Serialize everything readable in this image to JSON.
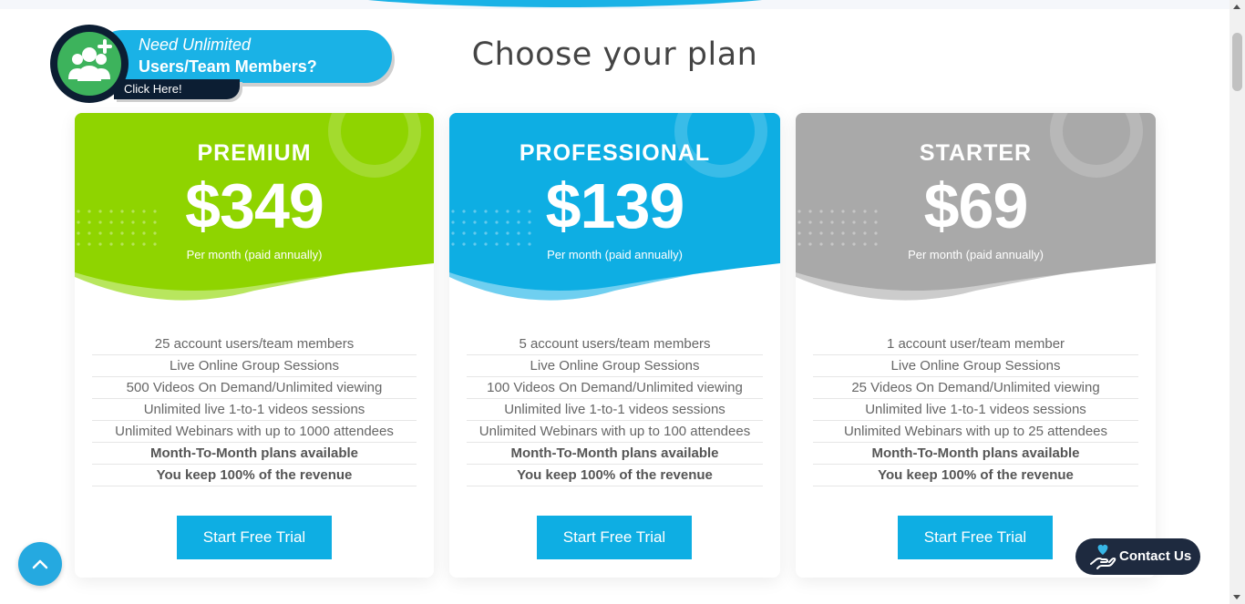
{
  "page": {
    "title": "Choose your plan"
  },
  "promo": {
    "line1": "Need Unlimited",
    "line2": "Users/Team Members?",
    "click": "Click Here!"
  },
  "plans": [
    {
      "tier": "PREMIUM",
      "price": "$349",
      "period": "Per month (paid annually)",
      "color": "#8fd400",
      "features": [
        "25 account users/team members",
        "Live Online Group Sessions",
        "500 Videos On Demand/Unlimited viewing",
        "Unlimited live 1-to-1 videos sessions",
        "Unlimited Webinars with up to 1000 attendees",
        "Month-To-Month plans available",
        "You keep 100% of the revenue"
      ],
      "cta": "Start Free Trial"
    },
    {
      "tier": "PROFESSIONAL",
      "price": "$139",
      "period": "Per month (paid annually)",
      "color": "#0eaee3",
      "features": [
        "5 account users/team members",
        "Live Online Group Sessions",
        "100 Videos On Demand/Unlimited viewing",
        "Unlimited live 1-to-1 videos sessions",
        "Unlimited Webinars with up to 100 attendees",
        "Month-To-Month plans available",
        "You keep 100% of the revenue"
      ],
      "cta": "Start Free Trial"
    },
    {
      "tier": "STARTER",
      "price": "$69",
      "period": "Per month (paid annually)",
      "color": "#a9a9a9",
      "features": [
        "1 account user/team member",
        "Live Online Group Sessions",
        "25 Videos On Demand/Unlimited viewing",
        "Unlimited live 1-to-1 videos sessions",
        "Unlimited Webinars with up to 25 attendees",
        "Month-To-Month plans available",
        "You keep 100% of the revenue"
      ],
      "cta": "Start Free Trial"
    }
  ],
  "contact": {
    "label": "Contact Us"
  },
  "icons": {
    "back_to_top": "chevron-up-icon",
    "contact": "heart-hand-icon",
    "promo": "add-users-icon"
  }
}
